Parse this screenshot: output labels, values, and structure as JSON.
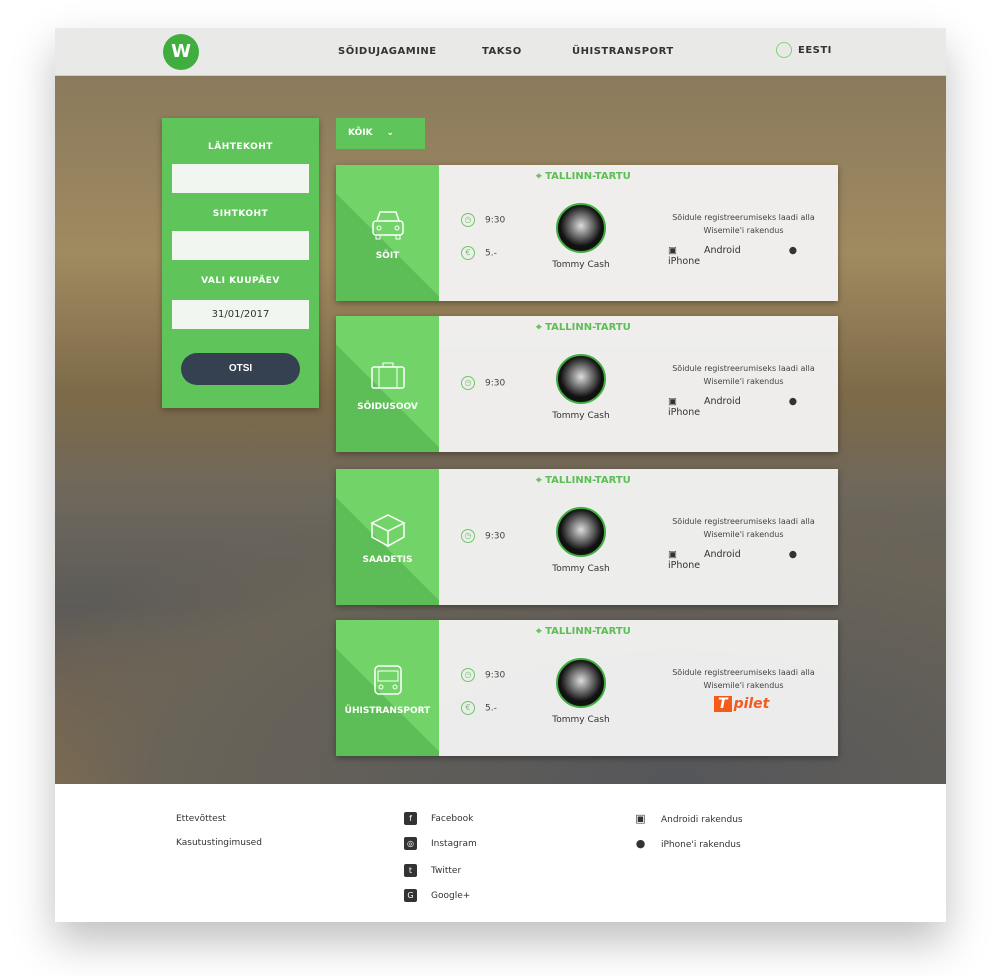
{
  "header": {
    "logo": "W",
    "nav": [
      "SÕIDUJAGAMINE",
      "TAKSO",
      "ÜHISTRANSPORT"
    ],
    "language": "EESTI"
  },
  "search": {
    "from_label": "LÄHTEKOHT",
    "from_value": "",
    "to_label": "SIHTKOHT",
    "to_value": "",
    "date_label": "VALI KUUPÄEV",
    "date_value": "31/01/2017",
    "button": "OTSI"
  },
  "filter": {
    "selected": "KÕIK"
  },
  "cards": [
    {
      "type": "SÕIT",
      "icon": "car-icon",
      "route": "TALLINN-TARTU",
      "time": "9:30",
      "price": "5.-",
      "driver": "Tommy Cash",
      "download_text": "Sõidule registreerumiseks laadi alla Wisemile'i rakendus",
      "apps": [
        "Android",
        "iPhone"
      ]
    },
    {
      "type": "SÕIDUSOOV",
      "icon": "suitcase-icon",
      "route": "TALLINN-TARTU",
      "time": "9:30",
      "driver": "Tommy Cash",
      "download_text": "Sõidule registreerumiseks laadi alla Wisemile'i rakendus",
      "apps": [
        "Android",
        "iPhone"
      ]
    },
    {
      "type": "SAADETIS",
      "icon": "package-icon",
      "route": "TALLINN-TARTU",
      "time": "9:30",
      "driver": "Tommy Cash",
      "download_text": "Sõidule registreerumiseks laadi alla Wisemile'i rakendus",
      "apps": [
        "Android",
        "iPhone"
      ]
    },
    {
      "type": "ÜHISTRANSPORT",
      "icon": "bus-icon",
      "route": "TALLINN-TARTU",
      "time": "9:30",
      "price": "5.-",
      "driver": "Tommy Cash",
      "download_text": "Sõidule registreerumiseks laadi alla Wisemile'i rakendus",
      "partner": "pilet",
      "partner_mark": "T"
    }
  ],
  "footer": {
    "links": [
      "Ettevõttest",
      "Kasutustingimused"
    ],
    "social": [
      "Facebook",
      "Instagram",
      "Twitter",
      "Google+"
    ],
    "apps": [
      "Androidi rakendus",
      "iPhone'i rakendus"
    ]
  },
  "colors": {
    "accent": "#5fc55a",
    "button": "#354050",
    "pilet": "#f45a1c"
  }
}
